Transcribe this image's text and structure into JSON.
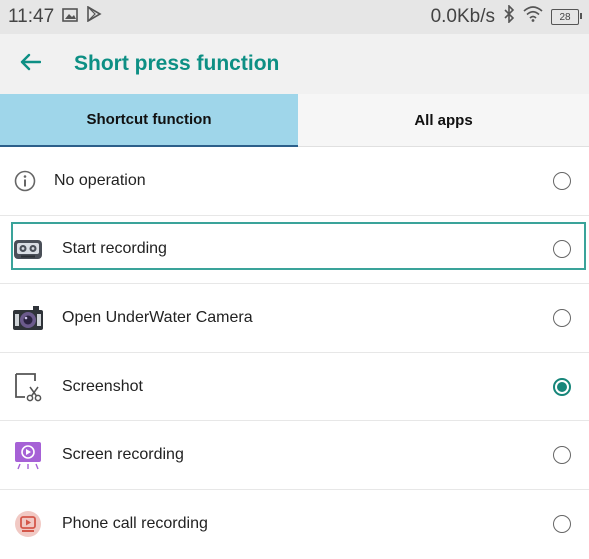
{
  "status_bar": {
    "time": "11:47",
    "network_speed": "0.0Kb/s",
    "battery_level": "28",
    "icons": [
      "image-icon",
      "play-store-icon",
      "bluetooth-icon",
      "wifi-icon",
      "battery-icon"
    ]
  },
  "header": {
    "back_icon": "arrow-left-icon",
    "title": "Short press function"
  },
  "tabs": [
    {
      "label": "Shortcut function",
      "active": true
    },
    {
      "label": "All apps",
      "active": false
    }
  ],
  "options": [
    {
      "label": "No operation",
      "icon": "info-icon",
      "selected": false
    },
    {
      "label": "Start recording",
      "icon": "recorder-icon",
      "selected": false
    },
    {
      "label": "Open UnderWater Camera",
      "icon": "camera-icon",
      "selected": false
    },
    {
      "label": "Screenshot",
      "icon": "screenshot-icon",
      "selected": true
    },
    {
      "label": "Screen recording",
      "icon": "screen-recording-icon",
      "selected": false
    },
    {
      "label": "Phone call recording",
      "icon": "call-recording-icon",
      "selected": false
    }
  ],
  "colors": {
    "accent": "#0d8f84",
    "tab_active_bg": "#9fd6ea",
    "status_bar_bg": "#e6e6e6",
    "header_bg": "#f1f1f1"
  }
}
